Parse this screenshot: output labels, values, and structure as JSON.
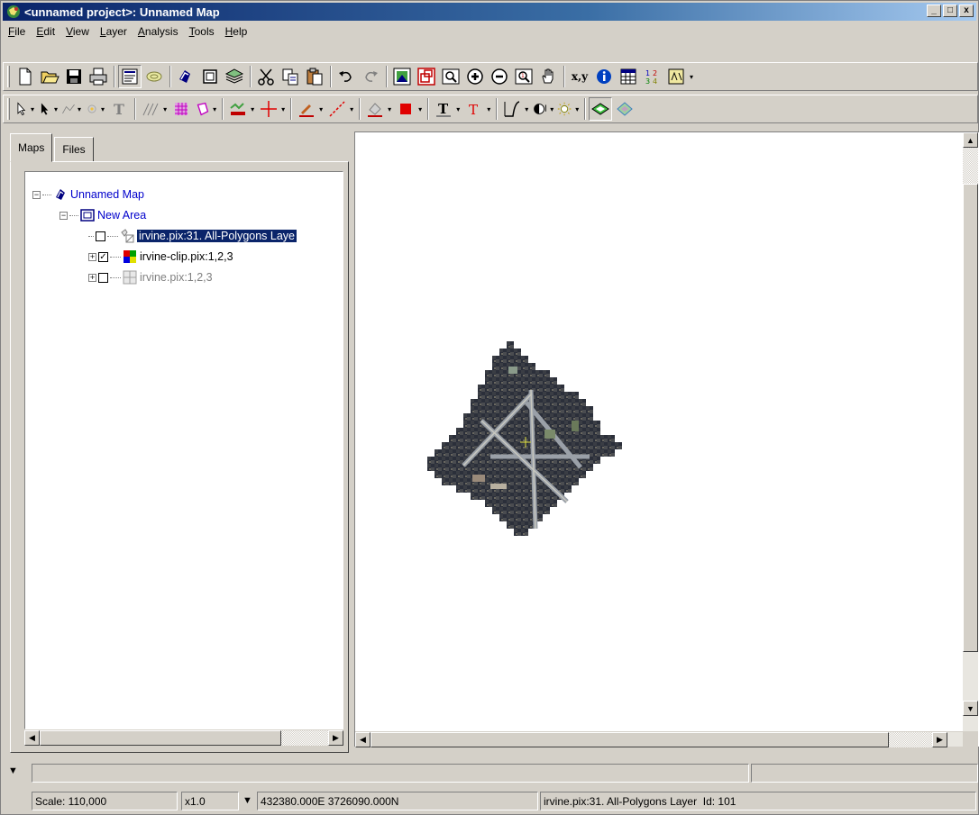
{
  "window": {
    "title": "<unnamed project>: Unnamed Map",
    "controls": {
      "minimize": "_",
      "maximize": "□",
      "close": "x"
    }
  },
  "menu": {
    "items": [
      {
        "label": "File",
        "key": "F"
      },
      {
        "label": "Edit",
        "key": "E"
      },
      {
        "label": "View",
        "key": "V"
      },
      {
        "label": "Layer",
        "key": "L"
      },
      {
        "label": "Analysis",
        "key": "A"
      },
      {
        "label": "Tools",
        "key": "T"
      },
      {
        "label": "Help",
        "key": "H"
      }
    ]
  },
  "toolbar1": {
    "icons": [
      "new-icon",
      "open-icon",
      "save-icon",
      "print-icon",
      "properties-icon",
      "layers-icon",
      "map-icon",
      "area-icon",
      "layer-stack-icon",
      "cut-icon",
      "copy-icon",
      "paste-icon",
      "undo-icon",
      "redo-icon",
      "zoom-extent-icon",
      "zoom-select-icon",
      "zoom-box-icon",
      "zoom-in-icon",
      "zoom-out-icon",
      "zoom-1-icon",
      "pan-icon",
      "coordinate-icon",
      "info-icon",
      "table-icon",
      "numbers-icon",
      "legend-icon"
    ],
    "coord_label": "x,y"
  },
  "toolbar2": {
    "icons": [
      "select-arrow-icon",
      "pointer-icon",
      "line-edit-icon",
      "point-icon",
      "text-tool-icon",
      "pen-icon",
      "grid-icon",
      "polygon-icon",
      "fill-icon",
      "crosshair-icon",
      "pencil-icon",
      "line-icon",
      "eraser-icon",
      "color-box-icon",
      "text-style-icon",
      "text-color-icon",
      "function-icon",
      "contrast-icon",
      "brightness-icon",
      "visibility-icon",
      "visibility-alt-icon"
    ]
  },
  "left_panel": {
    "tabs": [
      {
        "label": "Maps",
        "active": true
      },
      {
        "label": "Files",
        "active": false
      }
    ],
    "tree": [
      {
        "label": "Unnamed Map",
        "level": 0,
        "type": "map"
      },
      {
        "label": "New Area",
        "level": 1,
        "type": "area"
      },
      {
        "label": "irvine.pix:31. All-Polygons Laye",
        "level": 2,
        "type": "vector",
        "checked": false,
        "selected": true
      },
      {
        "label": "irvine-clip.pix:1,2,3",
        "level": 2,
        "type": "raster",
        "checked": true,
        "selected": false
      },
      {
        "label": "irvine.pix:1,2,3",
        "level": 2,
        "type": "raster-grey",
        "checked": false,
        "selected": false
      }
    ]
  },
  "status": {
    "scale": "Scale: 110,000",
    "zoom": "x1.0",
    "coords": "432380.000E 3726090.000N",
    "layer": "irvine.pix:31. All-Polygons Layer  Id: 101"
  },
  "colors": {
    "title_start": "#0a246a",
    "title_end": "#a6caf0",
    "selection": "#0a246a",
    "link": "#0000cc",
    "face": "#d4d0c8"
  }
}
